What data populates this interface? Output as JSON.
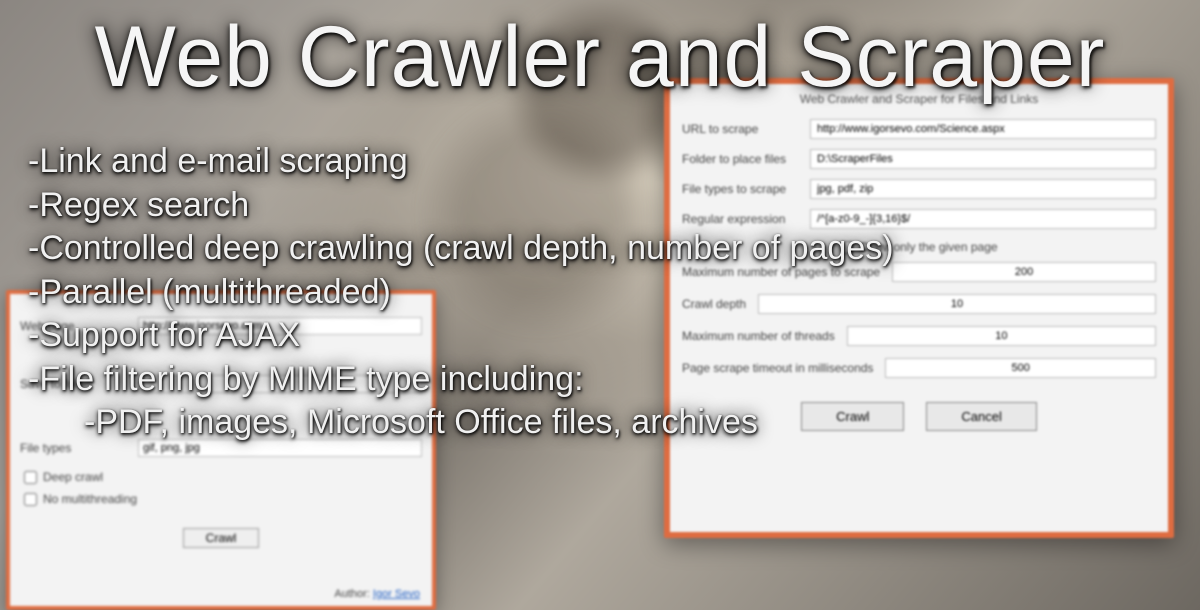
{
  "title": "Web Crawler and Scraper",
  "features": {
    "f1": "-Link and e-mail scraping",
    "f2": "-Regex search",
    "f3": "-Controlled deep crawling (crawl depth, number of pages)",
    "f4": "-Parallel (multithreaded)",
    "f5": "-Support for AJAX",
    "f6": "-File filtering by MIME type including:",
    "f7": "-PDF, images, Microsoft Office files, archives"
  },
  "left_dialog": {
    "webpage_label": "Web page",
    "webpage_value": "http://www.igorsevo.com",
    "saveto_label": "Save to folder",
    "saveto_value": "",
    "filetypes_label": "File types",
    "filetypes_value": "gif, png, jpg",
    "deep_crawl": "Deep crawl",
    "no_multithreading": "No multithreading",
    "crawl_button": "Crawl",
    "author_label": "Author:",
    "author_name": "Igor Sevo"
  },
  "right_dialog": {
    "header": "Web Crawler and Scraper for Files and Links",
    "url_label": "URL to scrape",
    "url_value": "http://www.igorsevo.com/Science.aspx",
    "folder_label": "Folder to place files",
    "folder_value": "D:\\ScraperFiles",
    "types_label": "File types to scrape",
    "types_value": "jpg, pdf, zip",
    "regex_label": "Regular expression",
    "regex_value": "/^[a-z0-9_-]{3,16}$/",
    "crawl_only": "Crawl only the given page",
    "max_pages_label": "Maximum number of pages to scrape",
    "max_pages_value": "200",
    "depth_label": "Crawl depth",
    "depth_value": "10",
    "threads_label": "Maximum number of threads",
    "threads_value": "10",
    "timeout_label": "Page scrape timeout in milliseconds",
    "timeout_value": "500",
    "crawl_button": "Crawl",
    "cancel_button": "Cancel"
  }
}
